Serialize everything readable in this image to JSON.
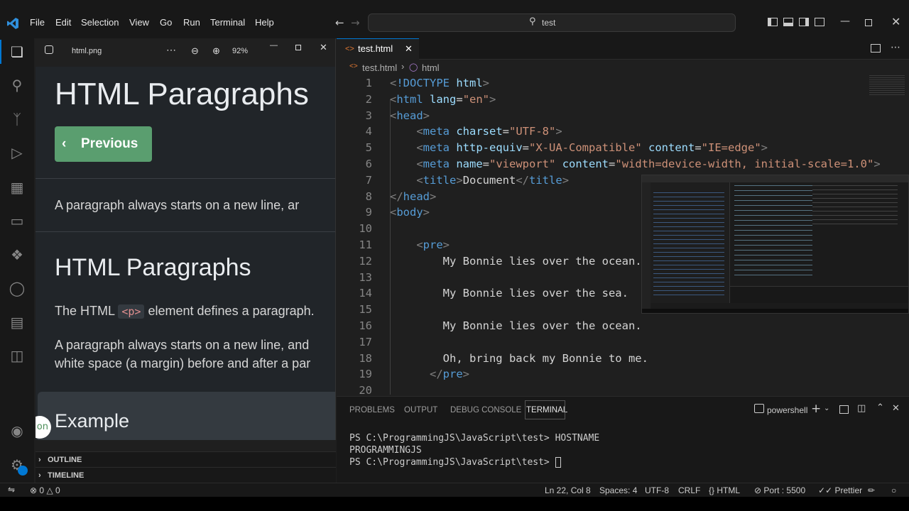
{
  "menu": [
    "File",
    "Edit",
    "Selection",
    "View",
    "Go",
    "Run",
    "Terminal",
    "Help"
  ],
  "command_center": "test",
  "viewer": {
    "filename": "html.png",
    "zoom": "92%",
    "h1_top": "HTML Paragraphs",
    "prev_label": "Previous",
    "para1": "A paragraph always starts on a new line, ar",
    "h2": "HTML Paragraphs",
    "defines_pre": "The HTML",
    "defines_code": "<p>",
    "defines_post": "element defines a paragraph.",
    "para2_line1": "A paragraph always starts on a new line, and",
    "para2_line2": "white space (a margin) before and after a par",
    "example": "Example",
    "bubble": "on"
  },
  "sidebar": {
    "outline": "OUTLINE",
    "timeline": "TIMELINE"
  },
  "editor": {
    "tab_label": "test.html",
    "breadcrumb_file": "test.html",
    "breadcrumb_node": "html",
    "line_numbers": [
      "1",
      "2",
      "3",
      "4",
      "5",
      "6",
      "7",
      "8",
      "9",
      "10",
      "11",
      "12",
      "13",
      "14",
      "15",
      "16",
      "17",
      "18",
      "19",
      "20"
    ],
    "lines": [
      "<!DOCTYPE html>",
      "<html lang=\"en\">",
      "<head>",
      "    <meta charset=\"UTF-8\">",
      "    <meta http-equiv=\"X-UA-Compatible\" content=\"IE=edge\">",
      "    <meta name=\"viewport\" content=\"width=device-width, initial-scale=1.0\">",
      "    <title>Document</title>",
      "</head>",
      "<body>",
      "",
      "    <pre>",
      "        My Bonnie lies over the ocean.",
      "",
      "        My Bonnie lies over the sea.",
      "",
      "        My Bonnie lies over the ocean.",
      "",
      "        Oh, bring back my Bonnie to me.",
      "      </pre>",
      ""
    ]
  },
  "panel": {
    "tabs": [
      "PROBLEMS",
      "OUTPUT",
      "DEBUG CONSOLE",
      "TERMINAL"
    ],
    "shell": "powershell",
    "terminal_lines": [
      "PS C:\\ProgrammingJS\\JavaScript\\test> HOSTNAME",
      "PROGRAMMINGJS",
      "PS C:\\ProgrammingJS\\JavaScript\\test> "
    ]
  },
  "status": {
    "errors": "0",
    "warnings": "0",
    "position": "Ln 22, Col 8",
    "spaces": "Spaces: 4",
    "encoding": "UTF-8",
    "eol": "CRLF",
    "language": "HTML",
    "port": "Port : 5500",
    "formatter": "Prettier"
  },
  "colors": {
    "accent": "#0078d4",
    "button_green": "#5a9e6f",
    "tag": "#569cd6",
    "attr": "#9cdcfe",
    "string": "#ce9178"
  }
}
